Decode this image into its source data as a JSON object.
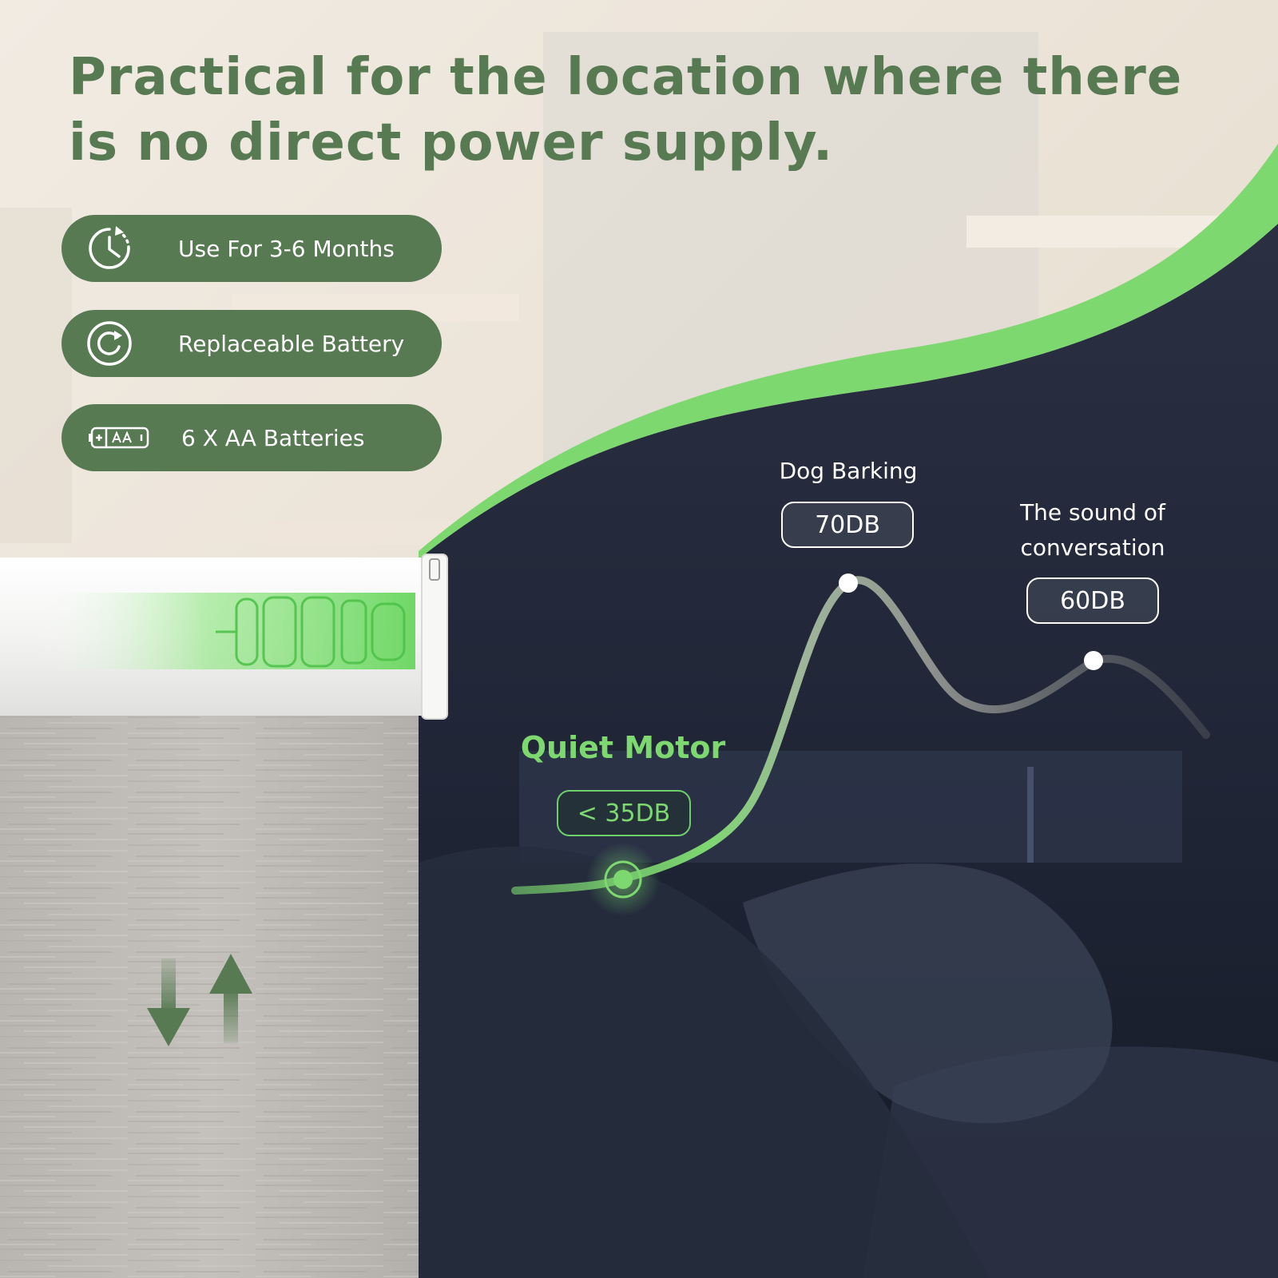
{
  "headline": "Practical for the location where there is no direct power supply.",
  "features": [
    {
      "icon": "timer-clock-icon",
      "label": "Use For 3-6 Months"
    },
    {
      "icon": "refresh-circle-icon",
      "label": "Replaceable Battery"
    },
    {
      "icon": "aa-battery-icon",
      "label": "6 X AA Batteries"
    }
  ],
  "noise_levels": {
    "dog": {
      "label": "Dog Barking",
      "value": "70DB"
    },
    "conversation": {
      "label_line1": "The sound of",
      "label_line2": "conversation",
      "value": "60DB"
    },
    "motor": {
      "label": "Quiet Motor",
      "value": "< 35DB"
    }
  },
  "colors": {
    "brand_green": "#577a52",
    "accent_green": "#7dd870",
    "dark_navy": "#1c2232",
    "pill_text": "#ffffff"
  },
  "icons": {
    "arrows": "up-down-arrows-icon"
  }
}
